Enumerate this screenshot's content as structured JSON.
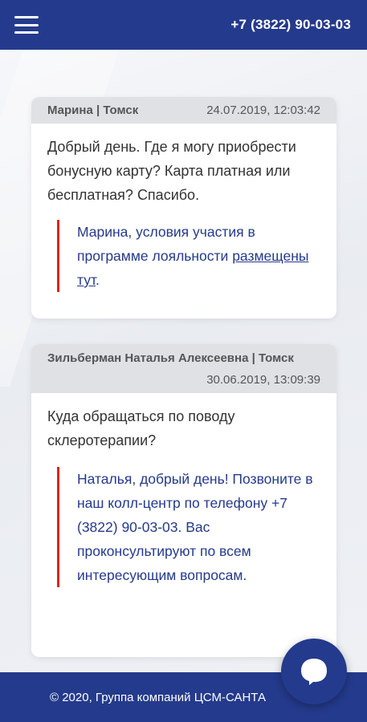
{
  "header": {
    "menu_icon": "hamburger-icon",
    "phone": "+7 (3822) 90-03-03"
  },
  "colors": {
    "brand": "#243a8c",
    "accent": "#e0241b",
    "card_header": "#dfe1e5"
  },
  "messages": [
    {
      "author": "Марина | Томск",
      "date": "24.07.2019, 12:03:42",
      "question": "Добрый день. Где я могу приобрести бонусную карту? Карта платная или бесплатная? Спасибо.",
      "answer_text": "Марина, условия участия в программе лояльности ",
      "answer_link": "размещены тут",
      "answer_tail": "."
    },
    {
      "author": "Зильберман Наталья Алексеевна | Томск",
      "date": "30.06.2019, 13:09:39",
      "question": "Куда обращаться по поводу склеротерапии?",
      "answer_text": "Наталья, добрый день! Позвоните в наш колл-центр по телефону +7 (3822) 90-03-03. Вас проконсультируют по всем интересующим вопросам."
    }
  ],
  "footer": {
    "copyright": "© 2020, Группа компаний ЦСМ-САНТА"
  },
  "chat_button": {
    "icon": "chat-bubble-icon"
  }
}
